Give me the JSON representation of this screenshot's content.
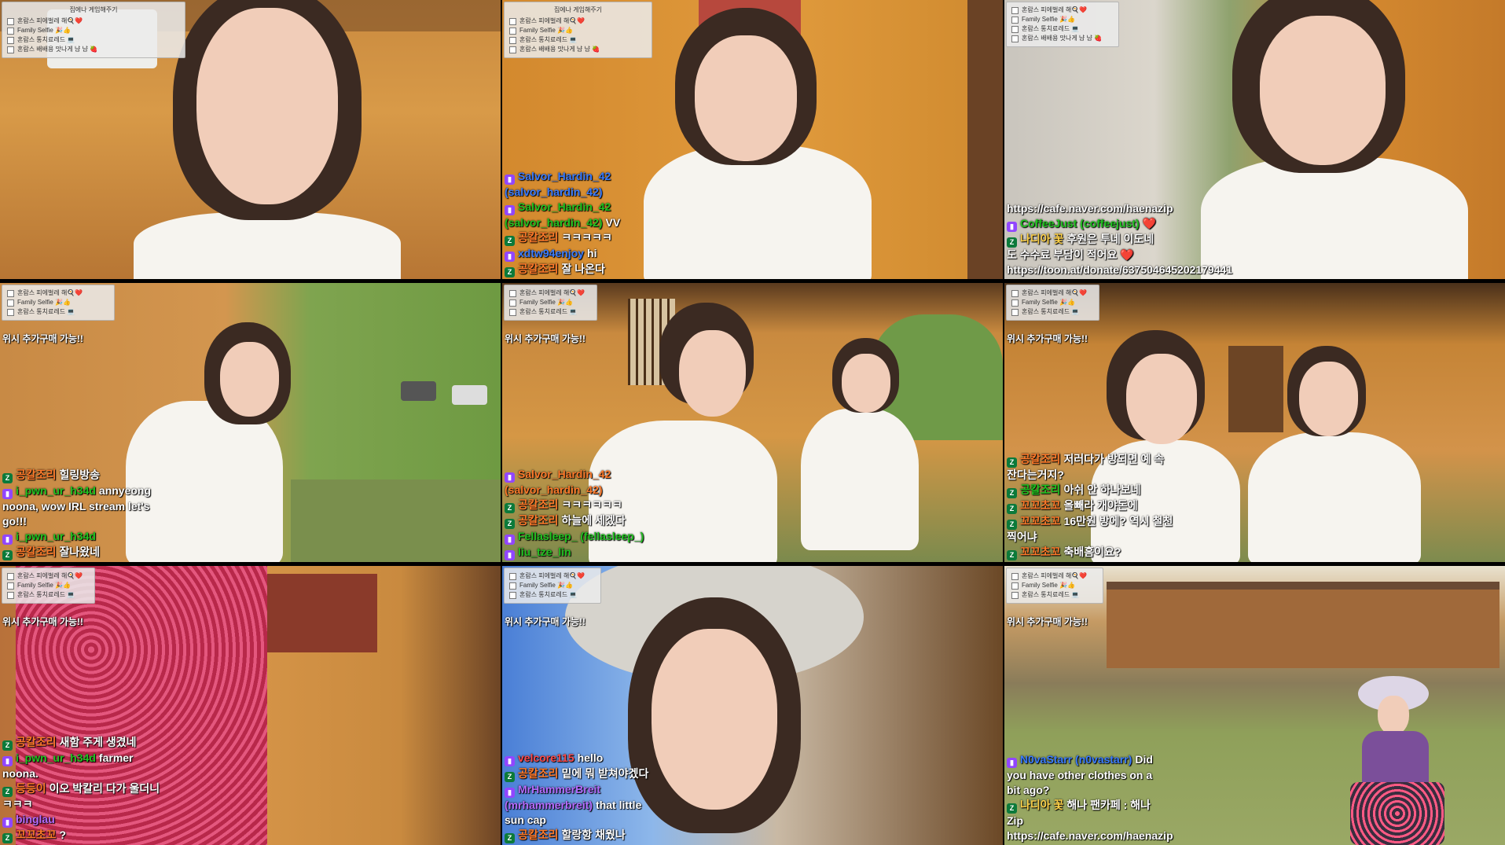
{
  "panel": {
    "title": "집에나 게임해주기",
    "items": [
      "혼람스 피에벌레 해🍳❤️",
      "Family Selfie 🎉👍",
      "혼람스 통치료레드 💻",
      "혼람스 배배용 맛나게 냠 냠 🍓"
    ]
  },
  "notice": "위시 추가구매 가능!!",
  "tiles": [
    {
      "id": "tile-1",
      "messages": []
    },
    {
      "id": "tile-2",
      "messages": [
        {
          "platform": "twitch",
          "user": "Salvor_Hardin_42 (salvor_hardin_42)",
          "user_color": "#3a7cff",
          "text": ""
        },
        {
          "platform": "twitch",
          "user": "Salvor_Hardin_42 (salvor_hardin_42)",
          "user_color": "#21c421",
          "text": "VV"
        },
        {
          "platform": "zone",
          "user": "공칼조리",
          "user_color": "#ff7a2a",
          "text": "ㅋㅋㅋㅋㅋ"
        },
        {
          "platform": "twitch",
          "user": "xdtw94enjoy",
          "user_color": "#3a7cff",
          "text": "hi"
        },
        {
          "platform": "zone",
          "user": "공칼조리",
          "user_color": "#ff7a2a",
          "text": "잘 나온다"
        }
      ]
    },
    {
      "id": "tile-3",
      "messages": [
        {
          "platform": "",
          "user": "",
          "user_color": "#ffffff",
          "text": "https://cafe.naver.com/haenazip"
        },
        {
          "platform": "twitch",
          "user": "CoffeeJust (coffeejust)",
          "user_color": "#21c421",
          "text": "❤️"
        },
        {
          "platform": "zone",
          "user": "나디아 꽃",
          "user_color": "#ffd24a",
          "text": "후원은 투네 이도네도 수수료 부담이 적어요 ❤️"
        },
        {
          "platform": "",
          "user": "",
          "user_color": "#ffffff",
          "text": "https://toon.at/donate/637504645202179441"
        }
      ]
    },
    {
      "id": "tile-4",
      "notice": true,
      "messages": [
        {
          "platform": "zone",
          "user": "공칼조리",
          "user_color": "#ff7a2a",
          "text": "힐링방송"
        },
        {
          "platform": "twitch",
          "user": "i_pwn_ur_h34d",
          "user_color": "#21c421",
          "text": "annyeong noona, wow IRL stream let's go!!!"
        },
        {
          "platform": "twitch",
          "user": "i_pwn_ur_h34d",
          "user_color": "#21c421",
          "text": ""
        },
        {
          "platform": "zone",
          "user": "공칼조리",
          "user_color": "#ff7a2a",
          "text": "잘나왔네"
        }
      ]
    },
    {
      "id": "tile-5",
      "notice": true,
      "messages": [
        {
          "platform": "twitch",
          "user": "Salvor_Hardin_42 (salvor_hardin_42)",
          "user_color": "#ff7a2a",
          "text": ""
        },
        {
          "platform": "zone",
          "user": "공칼조리",
          "user_color": "#ff7a2a",
          "text": "ㅋㅋㅋㅋㅋㅋ"
        },
        {
          "platform": "zone",
          "user": "공칼조리",
          "user_color": "#ff7a2a",
          "text": "하늘에 세겠다"
        },
        {
          "platform": "twitch",
          "user": "Fellasleep_ (fellasleep_)",
          "user_color": "#21c421",
          "text": ""
        },
        {
          "platform": "twitch",
          "user": "liu_tze_lin",
          "user_color": "#21c421",
          "text": ""
        }
      ]
    },
    {
      "id": "tile-6",
      "notice": true,
      "messages": [
        {
          "platform": "zone",
          "user": "공칼조리",
          "user_color": "#ff7a2a",
          "text": "저러다가 방되면 예 속 잔다는거지?"
        },
        {
          "platform": "zone",
          "user": "공칼조리",
          "user_color": "#21c421",
          "text": "아쉬 안 하나보네"
        },
        {
          "platform": "zone",
          "user": "꼬꼬초꼬",
          "user_color": "#ff7a2a",
          "text": "올빼라 개야돈에"
        },
        {
          "platform": "zone",
          "user": "꼬꼬초꼬",
          "user_color": "#ff7a2a",
          "text": "16만원 방에? 역시 철천 찍어냐"
        },
        {
          "platform": "zone",
          "user": "꼬꼬초꼬",
          "user_color": "#ff7a2a",
          "text": "축배홈이요?"
        }
      ]
    },
    {
      "id": "tile-7",
      "notice": true,
      "messages": [
        {
          "platform": "zone",
          "user": "공칼조리",
          "user_color": "#ff7a2a",
          "text": "새함 주게 생겼네"
        },
        {
          "platform": "twitch",
          "user": "i_pwn_ur_h34d",
          "user_color": "#21c421",
          "text": "farmer noona."
        },
        {
          "platform": "zone",
          "user": "등등이",
          "user_color": "#ff7a2a",
          "text": "이오 박칼리 다가 울더니 ㅋㅋㅋ"
        },
        {
          "platform": "twitch",
          "user": "binglau",
          "user_color": "#b56cff",
          "text": ""
        },
        {
          "platform": "zone",
          "user": "꼬꼬초꼬",
          "user_color": "#ff7a2a",
          "text": "?"
        }
      ]
    },
    {
      "id": "tile-8",
      "notice": true,
      "messages": [
        {
          "platform": "twitch",
          "user": "velcore115",
          "user_color": "#ff4a4a",
          "text": "hello"
        },
        {
          "platform": "zone",
          "user": "공칼조리",
          "user_color": "#ff7a2a",
          "text": "밑에 뭐 받쳐야겠다"
        },
        {
          "platform": "twitch",
          "user": "MrHammerBreit (mrhammerbreit)",
          "user_color": "#b56cff",
          "text": "that little sun cap"
        },
        {
          "platform": "zone",
          "user": "공칼조리",
          "user_color": "#ff7a2a",
          "text": "할랑항 채웠나"
        }
      ]
    },
    {
      "id": "tile-9",
      "notice": true,
      "messages": [
        {
          "platform": "twitch",
          "user": "N0vaStarr (n0vastarr)",
          "user_color": "#3a7cff",
          "text": "Did you have other clothes on a bit ago?"
        },
        {
          "platform": "zone",
          "user": "나디아 꽃",
          "user_color": "#ffd24a",
          "text": "해나 팬카페 : 해나 Zip"
        },
        {
          "platform": "",
          "user": "",
          "user_color": "#ffffff",
          "text": "https://cafe.naver.com/haenazip"
        }
      ]
    }
  ]
}
